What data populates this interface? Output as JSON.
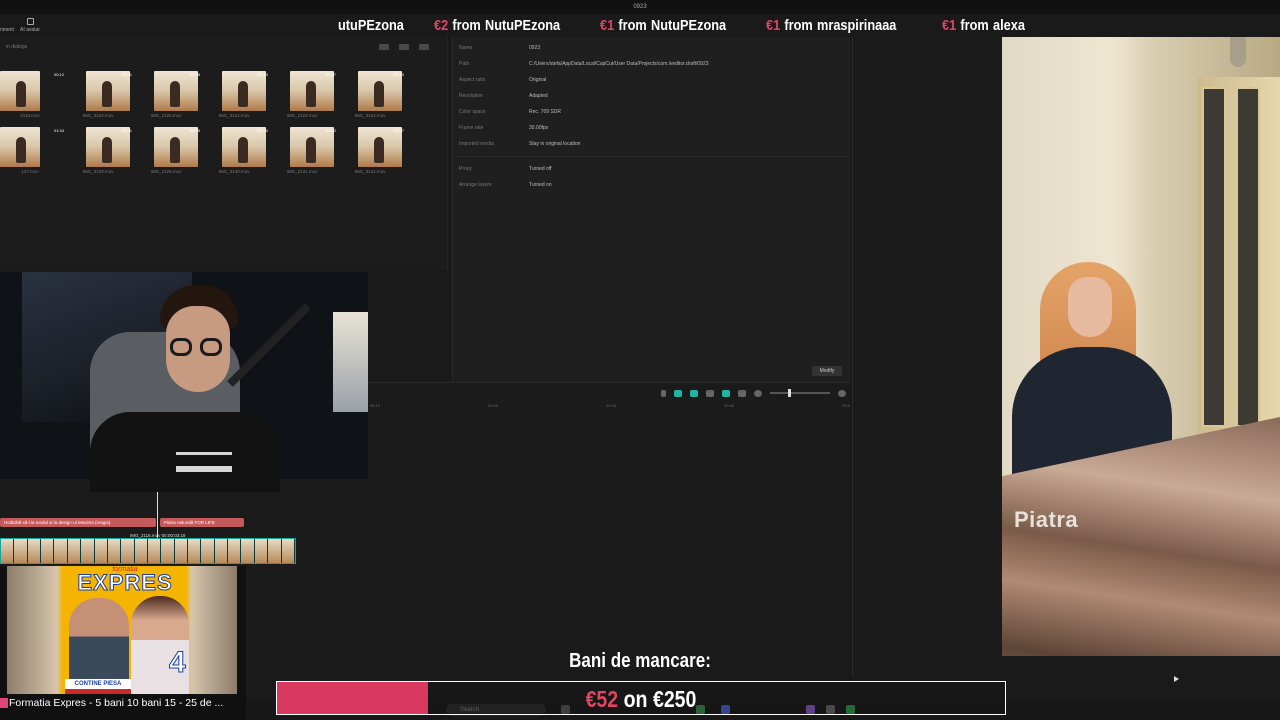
{
  "window_title": "0923",
  "ticker": {
    "items": [
      {
        "amount": "",
        "from": "",
        "name": "utuPEzona"
      },
      {
        "amount": "€2",
        "from": "from",
        "name": "NutuPEzona"
      },
      {
        "amount": "€1",
        "from": "from",
        "name": "NutuPEzona"
      },
      {
        "amount": "€1",
        "from": "from",
        "name": "mraspirinaaa"
      },
      {
        "amount": "€1",
        "from": "from",
        "name": "alexa"
      }
    ]
  },
  "editor": {
    "media_toolbar": {
      "left_label_1": "nment",
      "left_label_2": "AI avatar",
      "search_hint": "in dialogs"
    },
    "media_tiles": [
      {
        "name": "2118.mov",
        "duration": "00:12"
      },
      {
        "name": "IMG_2120.mov",
        "duration": "00:31"
      },
      {
        "name": "IMG_2120.mov",
        "duration": "01:38"
      },
      {
        "name": "IMG_2122.mov",
        "duration": "00:13"
      },
      {
        "name": "IMG_2123.mov",
        "duration": "00:37"
      },
      {
        "name": "IMG_2124.mov",
        "duration": "00:13"
      },
      {
        "name": "127.mov",
        "duration": "01:34"
      },
      {
        "name": "IMG_2128.mov",
        "duration": "00:21"
      },
      {
        "name": "IMG_2129.mov",
        "duration": "00:55"
      },
      {
        "name": "IMG_2130.mov",
        "duration": "01:54"
      },
      {
        "name": "IMG_2131.mov",
        "duration": "01:42"
      },
      {
        "name": "IMG_2132.mov",
        "duration": "00:07"
      }
    ],
    "project_info": {
      "rows": [
        {
          "label": "Name",
          "value": "0923"
        },
        {
          "label": "Path",
          "value": "C:/Users/stefa/AppData/Local/CapCut/User Data/Projects/com.lveditor.draft/0923"
        },
        {
          "label": "Aspect ratio",
          "value": "Original"
        },
        {
          "label": "Resolution",
          "value": "Adapted"
        },
        {
          "label": "Color space",
          "value": "Rec. 709 SDR"
        },
        {
          "label": "Frame rate",
          "value": "30.00fps"
        },
        {
          "label": "Imported media",
          "value": "Stay in original location"
        },
        {
          "label": "Proxy",
          "value": "Turned off"
        },
        {
          "label": "Arrange layers",
          "value": "Turned on"
        }
      ],
      "modify_label": "Modify"
    },
    "timeline": {
      "ruler": [
        "00:10",
        "00:20",
        "00:30",
        "00:40",
        "00:5"
      ],
      "text_clips": [
        "Hotărâtă să-l ia modul și la design-ul Maxima (magia)",
        "Piatra naturală FOR LIFE"
      ],
      "video_clip_label": "IMG_2116.mov  00:00:03:18"
    }
  },
  "video_overlay": {
    "caption": "Piatra"
  },
  "music": {
    "album_top": "formatia",
    "album_title": "EXPRES",
    "album_number": "4",
    "album_badge": "CONTINE PIESA",
    "now_playing": "Formatia Expres - 5 bani 10 bani 15 - 25 de ..."
  },
  "goal": {
    "label": "Bani de mancare:",
    "current": "€52",
    "separator": "on",
    "target": "€250",
    "progress": 0.208,
    "fill_color": "#d8395e"
  },
  "taskbar": {
    "search_placeholder": "Search"
  },
  "colors": {
    "accent_teal": "#1fb6a6",
    "donation_amount": "#e04560"
  }
}
